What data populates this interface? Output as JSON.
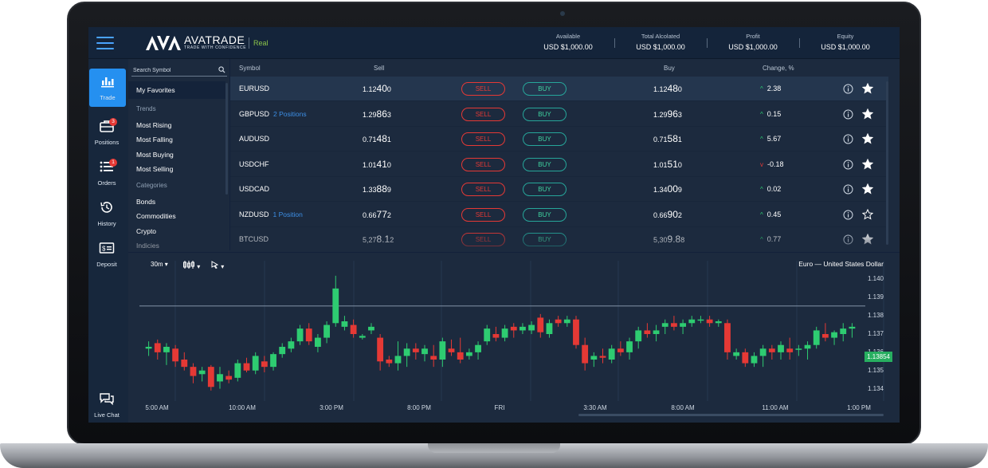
{
  "topbar": {
    "logo_name": "AVATRADE",
    "logo_tagline": "TRADE WITH CONFIDENCE",
    "account_mode": "Real",
    "stats": [
      {
        "label": "Available",
        "value": "USD $1,000.00"
      },
      {
        "label": "Total Alcolated",
        "value": "USD $1,000.00"
      },
      {
        "label": "Profit",
        "value": "USD $1,000.00"
      },
      {
        "label": "Equity",
        "value": "USD $1,000.00"
      }
    ]
  },
  "nav": {
    "items": [
      {
        "label": "Trade",
        "icon": "bar-chart-icon",
        "badge": ""
      },
      {
        "label": "Positions",
        "icon": "briefcase-icon",
        "badge": "3"
      },
      {
        "label": "Orders",
        "icon": "list-icon",
        "badge": "1"
      },
      {
        "label": "History",
        "icon": "history-icon",
        "badge": ""
      },
      {
        "label": "Deposit",
        "icon": "deposit-icon",
        "badge": ""
      }
    ],
    "live_chat": "Live Chat"
  },
  "symbols": {
    "search_placeholder": "Search Symbol",
    "favorites": "My Favorites",
    "trends_header": "Trends",
    "trends": [
      "Most Rising",
      "Most Falling",
      "Most Buying",
      "Most Selling"
    ],
    "categories_header": "Categories",
    "categories": [
      "Bonds",
      "Commodities",
      "Crypto",
      "Indicies"
    ]
  },
  "table": {
    "headers": {
      "symbol": "Symbol",
      "sell": "Sell",
      "buy": "Buy",
      "change": "Change, %"
    },
    "sell_label": "SELL",
    "buy_label": "BUY",
    "rows": [
      {
        "symbol": "EURUSD",
        "positions": "",
        "sell_a": "1.12",
        "sell_b": "40",
        "sell_c": "0",
        "buy_a": "1.12",
        "buy_b": "48",
        "buy_c": "0",
        "dir": "up",
        "change": "2.38",
        "favorite": true
      },
      {
        "symbol": "GBPUSD",
        "positions": "2 Positions",
        "sell_a": "1.29",
        "sell_b": "86",
        "sell_c": "3",
        "buy_a": "1.29",
        "buy_b": "96",
        "buy_c": "3",
        "dir": "up",
        "change": "0.15",
        "favorite": true
      },
      {
        "symbol": "AUDUSD",
        "positions": "",
        "sell_a": "0.71",
        "sell_b": "48",
        "sell_c": "1",
        "buy_a": "0.71",
        "buy_b": "58",
        "buy_c": "1",
        "dir": "up",
        "change": "5.67",
        "favorite": true
      },
      {
        "symbol": "USDCHF",
        "positions": "",
        "sell_a": "1.01",
        "sell_b": "41",
        "sell_c": "0",
        "buy_a": "1.01",
        "buy_b": "51",
        "buy_c": "0",
        "dir": "down",
        "change": "-0.18",
        "favorite": true
      },
      {
        "symbol": "USDCAD",
        "positions": "",
        "sell_a": "1.33",
        "sell_b": "88",
        "sell_c": "9",
        "buy_a": "1.34",
        "buy_b": "00",
        "buy_c": "9",
        "dir": "up",
        "change": "0.02",
        "favorite": true
      },
      {
        "symbol": "NZDUSD",
        "positions": "1 Position",
        "sell_a": "0.66",
        "sell_b": "77",
        "sell_c": "2",
        "buy_a": "0.66",
        "buy_b": "90",
        "buy_c": "2",
        "dir": "up",
        "change": "0.45",
        "favorite": false
      },
      {
        "symbol": "BTCUSD",
        "positions": "",
        "sell_a": "5,27",
        "sell_b": "8.1",
        "sell_c": "2",
        "buy_a": "5,30",
        "buy_b": "9.8",
        "buy_c": "8",
        "dir": "up",
        "change": "0.77",
        "favorite": true
      }
    ]
  },
  "chart": {
    "timeframe": "30m",
    "title": "Euro — United States Dollar",
    "current_price": "1.13854",
    "y_ticks": [
      "1.140",
      "1.139",
      "1.138",
      "1.137",
      "1.136",
      "1.135",
      "1.134"
    ],
    "x_ticks": [
      "5:00 AM",
      "10:00 AM",
      "3:00 PM",
      "8:00 PM",
      "FRI",
      "3:30 AM",
      "8:00 AM",
      "11:00 AM",
      "1:00 PM"
    ],
    "colors": {
      "up": "#2ecc71",
      "down": "#e53935"
    },
    "chart_data": {
      "type": "candlestick",
      "ylim": [
        1.1335,
        1.1405
      ],
      "candles": [
        [
          1.1362,
          1.1366,
          1.1358,
          1.1363
        ],
        [
          1.1365,
          1.1367,
          1.1356,
          1.136
        ],
        [
          1.136,
          1.1365,
          1.1353,
          1.1363
        ],
        [
          1.1362,
          1.1364,
          1.1352,
          1.1355
        ],
        [
          1.1356,
          1.136,
          1.135,
          1.1352
        ],
        [
          1.1352,
          1.1354,
          1.1343,
          1.1347
        ],
        [
          1.1348,
          1.1352,
          1.1344,
          1.135
        ],
        [
          1.1352,
          1.1353,
          1.1339,
          1.1341
        ],
        [
          1.1344,
          1.1352,
          1.134,
          1.1348
        ],
        [
          1.1347,
          1.135,
          1.1343,
          1.1345
        ],
        [
          1.1346,
          1.1356,
          1.1344,
          1.1354
        ],
        [
          1.1354,
          1.1357,
          1.1349,
          1.135
        ],
        [
          1.135,
          1.136,
          1.1348,
          1.1358
        ],
        [
          1.1355,
          1.1358,
          1.1349,
          1.1352
        ],
        [
          1.1352,
          1.136,
          1.135,
          1.1359
        ],
        [
          1.1359,
          1.1365,
          1.1357,
          1.1363
        ],
        [
          1.1362,
          1.1368,
          1.136,
          1.1366
        ],
        [
          1.1366,
          1.1375,
          1.1364,
          1.1373
        ],
        [
          1.1373,
          1.1376,
          1.1364,
          1.1366
        ],
        [
          1.1363,
          1.137,
          1.136,
          1.1368
        ],
        [
          1.1368,
          1.1377,
          1.1365,
          1.1375
        ],
        [
          1.1376,
          1.1402,
          1.1374,
          1.1395
        ],
        [
          1.1374,
          1.138,
          1.1372,
          1.1377
        ],
        [
          1.1375,
          1.1378,
          1.1368,
          1.137
        ],
        [
          1.1368,
          1.137,
          1.1367,
          1.1369
        ],
        [
          1.1372,
          1.1376,
          1.137,
          1.1374
        ],
        [
          1.1368,
          1.137,
          1.135,
          1.1355
        ],
        [
          1.1356,
          1.1358,
          1.1352,
          1.1354
        ],
        [
          1.1354,
          1.1366,
          1.135,
          1.1358
        ],
        [
          1.1358,
          1.1365,
          1.1352,
          1.1362
        ],
        [
          1.1362,
          1.1365,
          1.1356,
          1.136
        ],
        [
          1.1359,
          1.1364,
          1.1355,
          1.1362
        ],
        [
          1.1358,
          1.1364,
          1.1352,
          1.1356
        ],
        [
          1.1356,
          1.1368,
          1.1352,
          1.1366
        ],
        [
          1.1362,
          1.1367,
          1.1358,
          1.136
        ],
        [
          1.136,
          1.1368,
          1.1354,
          1.1356
        ],
        [
          1.1358,
          1.1362,
          1.1356,
          1.136
        ],
        [
          1.136,
          1.1366,
          1.1356,
          1.1364
        ],
        [
          1.1366,
          1.1375,
          1.1364,
          1.1373
        ],
        [
          1.137,
          1.1374,
          1.1366,
          1.1368
        ],
        [
          1.1368,
          1.1375,
          1.1366,
          1.1373
        ],
        [
          1.1374,
          1.1376,
          1.1368,
          1.1372
        ],
        [
          1.1372,
          1.1376,
          1.137,
          1.1374
        ],
        [
          1.1372,
          1.1377,
          1.137,
          1.1375
        ],
        [
          1.1379,
          1.1381,
          1.1368,
          1.1371
        ],
        [
          1.137,
          1.1378,
          1.1368,
          1.1376
        ],
        [
          1.1378,
          1.138,
          1.1374,
          1.1376
        ],
        [
          1.1376,
          1.138,
          1.1374,
          1.1378
        ],
        [
          1.1378,
          1.138,
          1.1362,
          1.1364
        ],
        [
          1.1364,
          1.1368,
          1.135,
          1.1354
        ],
        [
          1.1356,
          1.136,
          1.1352,
          1.1358
        ],
        [
          1.1358,
          1.1362,
          1.1354,
          1.1357
        ],
        [
          1.1356,
          1.1364,
          1.1354,
          1.1362
        ],
        [
          1.1362,
          1.1366,
          1.1358,
          1.136
        ],
        [
          1.136,
          1.1368,
          1.1356,
          1.1366
        ],
        [
          1.1366,
          1.1374,
          1.1362,
          1.1372
        ],
        [
          1.1372,
          1.1376,
          1.1368,
          1.137
        ],
        [
          1.137,
          1.1375,
          1.1366,
          1.1372
        ],
        [
          1.1374,
          1.1378,
          1.137,
          1.1376
        ],
        [
          1.1376,
          1.138,
          1.1372,
          1.1374
        ],
        [
          1.1374,
          1.1378,
          1.137,
          1.1376
        ],
        [
          1.1376,
          1.138,
          1.1374,
          1.1378
        ],
        [
          1.1378,
          1.138,
          1.1376,
          1.1378
        ],
        [
          1.1378,
          1.138,
          1.1374,
          1.1376
        ],
        [
          1.1376,
          1.1378,
          1.1374,
          1.1377
        ],
        [
          1.1376,
          1.1378,
          1.1356,
          1.136
        ],
        [
          1.1358,
          1.1362,
          1.1356,
          1.136
        ],
        [
          1.136,
          1.1362,
          1.1352,
          1.1354
        ],
        [
          1.1354,
          1.136,
          1.1352,
          1.1358
        ],
        [
          1.1358,
          1.1364,
          1.1352,
          1.1362
        ],
        [
          1.1362,
          1.1364,
          1.1356,
          1.136
        ],
        [
          1.136,
          1.1366,
          1.1356,
          1.1364
        ],
        [
          1.1362,
          1.1368,
          1.1356,
          1.136
        ],
        [
          1.1362,
          1.1364,
          1.1358,
          1.1362
        ],
        [
          1.1362,
          1.1366,
          1.1356,
          1.1364
        ],
        [
          1.1364,
          1.1374,
          1.1362,
          1.1372
        ],
        [
          1.137,
          1.1376,
          1.1366,
          1.1368
        ],
        [
          1.1368,
          1.1372,
          1.1364,
          1.1371
        ],
        [
          1.137,
          1.1376,
          1.1366,
          1.1373
        ],
        [
          1.1373,
          1.1376,
          1.1368,
          1.1374
        ]
      ]
    }
  }
}
